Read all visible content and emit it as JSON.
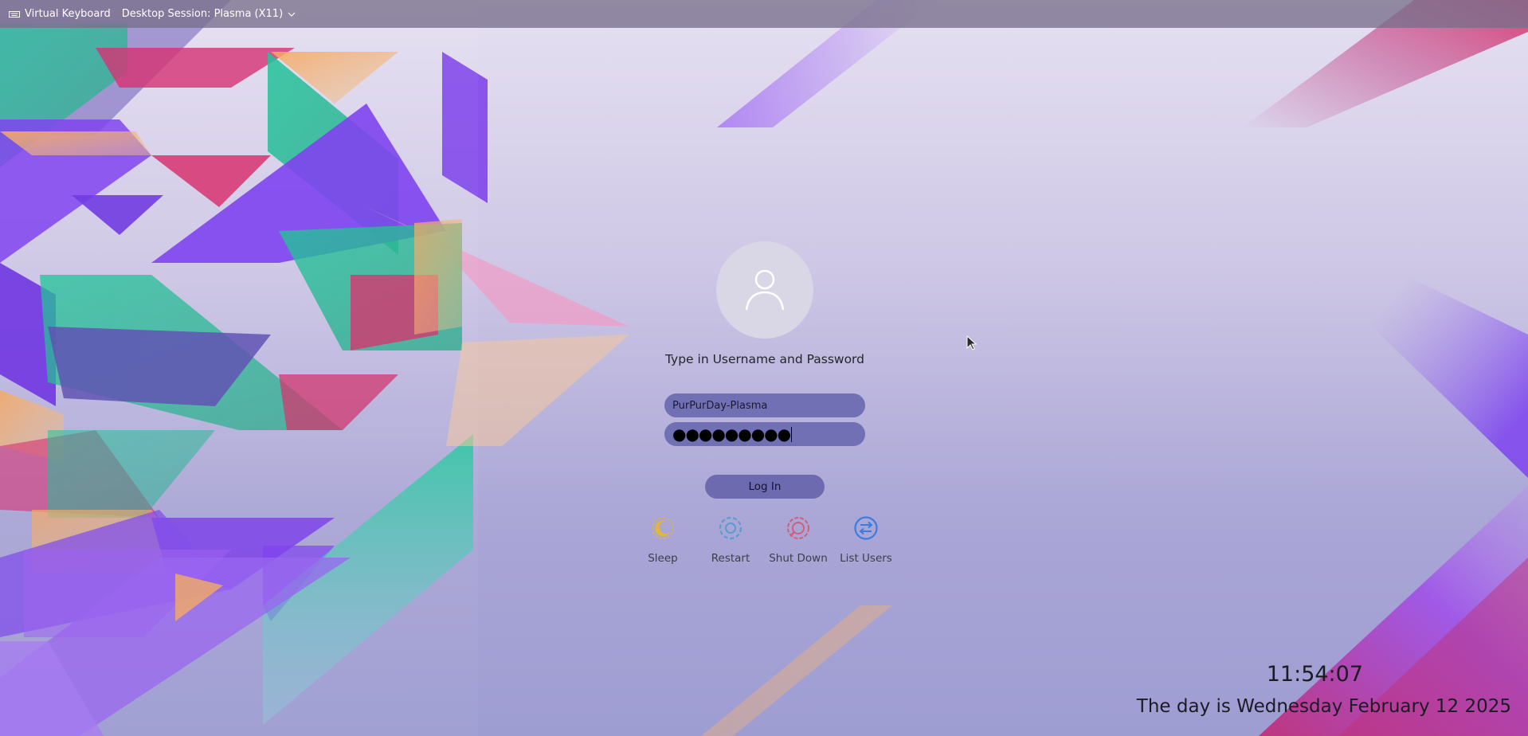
{
  "topbar": {
    "virtual_keyboard_label": "Virtual Keyboard",
    "session_label": "Desktop Session: Plasma (X11)"
  },
  "login": {
    "prompt": "Type in Username and Password",
    "username_value": "PurPurDay-Plasma",
    "password_value": "●●●●●●●●●",
    "login_button": "Log In"
  },
  "actions": [
    {
      "label": "Sleep",
      "icon": "sleep-icon",
      "color": "#e3b53a"
    },
    {
      "label": "Restart",
      "icon": "restart-icon",
      "color": "#5a9bd0"
    },
    {
      "label": "Shut Down",
      "icon": "shutdown-icon",
      "color": "#d0607a"
    },
    {
      "label": "List Users",
      "icon": "list-users-icon",
      "color": "#3d7ce0"
    }
  ],
  "clock": {
    "time": "11:54:07",
    "date": "The day is Wednesday February 12 2025"
  },
  "colors": {
    "field_bg": "#7270b4",
    "button_bg": "#6d6aaf",
    "topbar_bg": "#78708c"
  }
}
